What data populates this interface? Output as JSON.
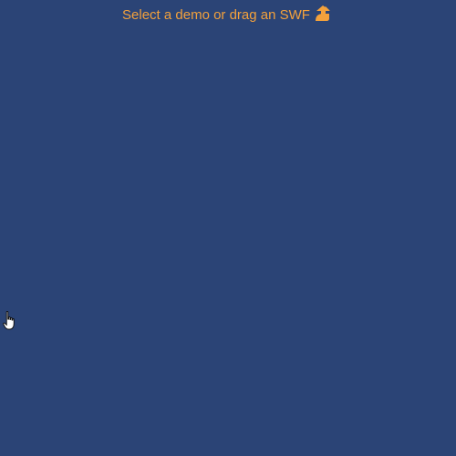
{
  "player": {
    "prompt_text": "Select a demo or drag an SWF",
    "prompt_icon": "curved-up-arrow-icon",
    "background_color": "#2b4476",
    "accent_color": "#f3a13c"
  },
  "cursor": {
    "icon": "hand-pointer-icon"
  }
}
